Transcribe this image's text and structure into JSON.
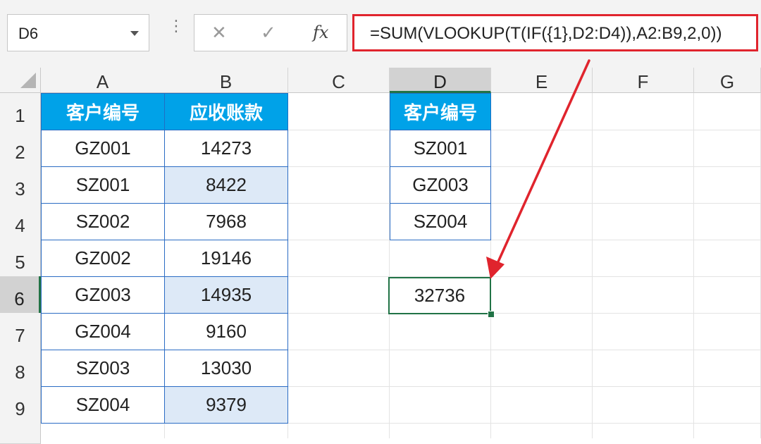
{
  "formula_bar": {
    "name_box": "D6",
    "cancel_icon": "✕",
    "enter_icon": "✓",
    "fx_label": "fx",
    "formula": "=SUM(VLOOKUP(T(IF({1},D2:D4)),A2:B9,2,0))"
  },
  "columns": [
    "A",
    "B",
    "C",
    "D",
    "E",
    "F",
    "G"
  ],
  "selected_column": "D",
  "rows": [
    "1",
    "2",
    "3",
    "4",
    "5",
    "6",
    "7",
    "8",
    "9"
  ],
  "selected_row": "6",
  "table_main": {
    "headers": [
      "客户编号",
      "应收账款"
    ],
    "rows": [
      [
        "GZ001",
        "14273"
      ],
      [
        "SZ001",
        "8422"
      ],
      [
        "SZ002",
        "7968"
      ],
      [
        "GZ002",
        "19146"
      ],
      [
        "GZ003",
        "14935"
      ],
      [
        "GZ004",
        "9160"
      ],
      [
        "SZ003",
        "13030"
      ],
      [
        "SZ004",
        "9379"
      ]
    ],
    "highlighted_b_rows": [
      3,
      6,
      9
    ]
  },
  "lookup_table": {
    "header": "客户编号",
    "values": [
      "SZ001",
      "GZ003",
      "SZ004"
    ]
  },
  "result_cell": {
    "address": "D6",
    "value": "32736"
  },
  "colors": {
    "header_fill": "#00a2e8",
    "table_border": "#2b6cc4",
    "highlight_fill": "#dde9f7",
    "selection": "#217346",
    "annotation_red": "#e0242d"
  }
}
